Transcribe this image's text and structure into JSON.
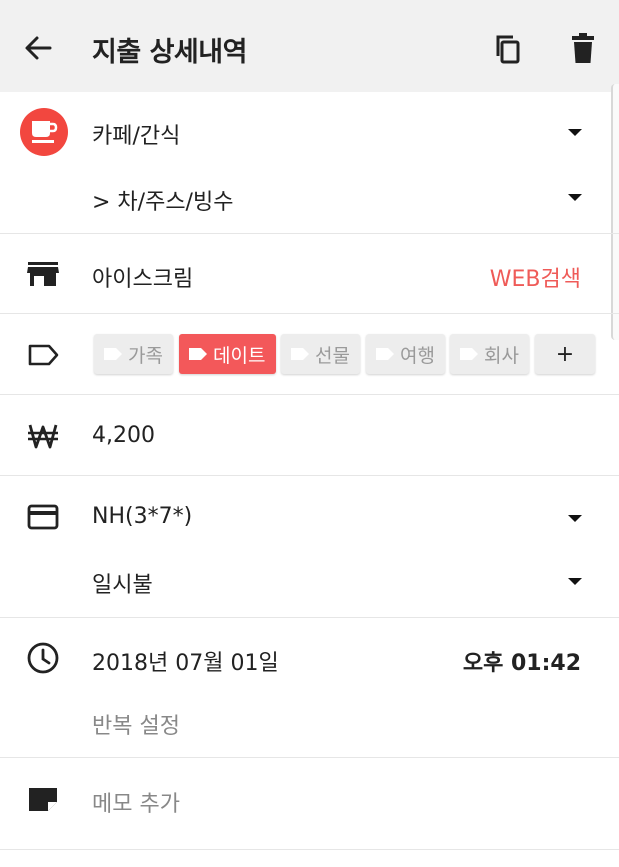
{
  "header": {
    "title": "지출 상세내역"
  },
  "category": {
    "main": "카페/간식",
    "sub": ">  차/주스/빙수"
  },
  "store": {
    "name": "아이스크림",
    "web_search": "WEB검색"
  },
  "tags": {
    "items": [
      {
        "label": "가족",
        "active": false
      },
      {
        "label": "데이트",
        "active": true
      },
      {
        "label": "선물",
        "active": false
      },
      {
        "label": "여행",
        "active": false
      },
      {
        "label": "회사",
        "active": false
      }
    ],
    "add_label": "+"
  },
  "amount": {
    "value": "4,200"
  },
  "payment": {
    "card": "NH(3*7*)",
    "installment": "일시불"
  },
  "datetime": {
    "date": "2018년 07월 01일",
    "time": "오후 01:42",
    "repeat": "반복 설정"
  },
  "memo": {
    "placeholder": "메모 추가"
  },
  "colors": {
    "accent": "#f3585a",
    "category_badge": "#f2473f",
    "web_link": "#ef5b58",
    "appbar": "#f1f1f1"
  },
  "icons": {
    "back": "arrow-left-icon",
    "copy": "copy-icon",
    "delete": "trash-icon",
    "category": "coffee-cup-icon",
    "store": "storefront-icon",
    "tag": "tag-icon",
    "amount": "won-icon",
    "payment": "credit-card-icon",
    "datetime": "clock-icon",
    "memo": "memo-icon"
  }
}
